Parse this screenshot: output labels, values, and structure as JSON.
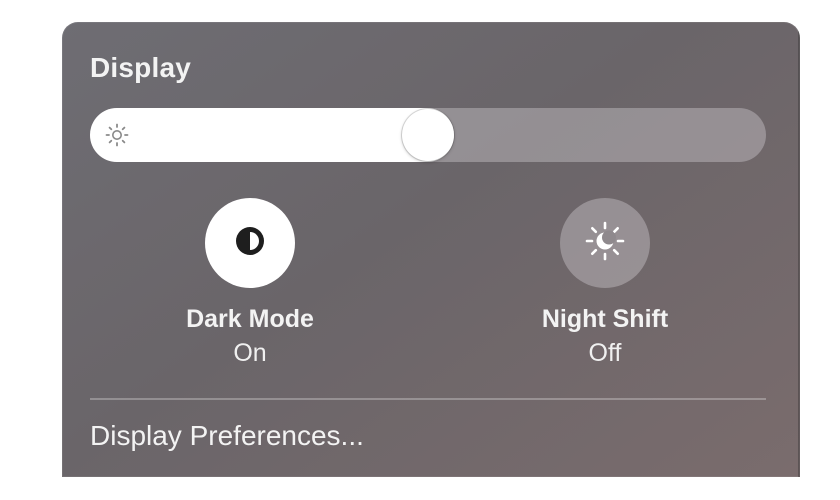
{
  "section": {
    "title": "Display"
  },
  "brightness": {
    "level": 0.5,
    "icon": "sun-small-icon"
  },
  "toggles": [
    {
      "label": "Dark Mode",
      "state": "On",
      "active": true,
      "icon": "dark-mode-icon"
    },
    {
      "label": "Night Shift",
      "state": "Off",
      "active": false,
      "icon": "night-shift-icon"
    }
  ],
  "footer": {
    "preferences_label": "Display Preferences..."
  }
}
